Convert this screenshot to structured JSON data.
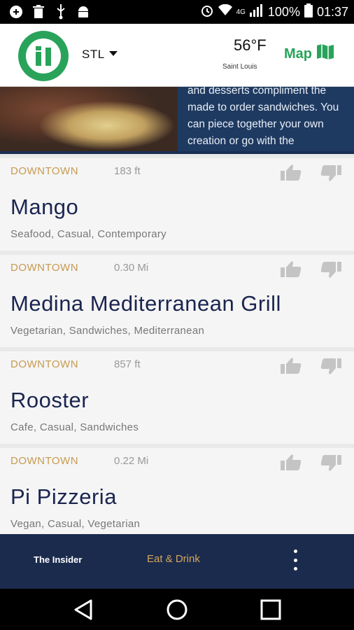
{
  "status_bar": {
    "battery_text": "100%",
    "time": "01:37",
    "network": "4G"
  },
  "header": {
    "city": "STL",
    "temperature": "56°F",
    "weather_city": "Saint Louis",
    "map_label": "Map",
    "brand_color": "#29a35a"
  },
  "banner": {
    "text": "and desserts compliment the made to order sandwiches. You can piece together your own creation or go with the"
  },
  "restaurants": [
    {
      "area": "DOWNTOWN",
      "distance": "183 ft",
      "name": "Mango",
      "tags": "Seafood, Casual, Contemporary"
    },
    {
      "area": "DOWNTOWN",
      "distance": "0.30 Mi",
      "name": "Medina Mediterranean Grill",
      "tags": "Vegetarian, Sandwiches, Mediterranean"
    },
    {
      "area": "DOWNTOWN",
      "distance": "857 ft",
      "name": "Rooster",
      "tags": "Cafe, Casual, Sandwiches"
    },
    {
      "area": "DOWNTOWN",
      "distance": "0.22 Mi",
      "name": "Pi Pizzeria",
      "tags": "Vegan, Casual, Vegetarian"
    }
  ],
  "tabbar": {
    "insider_label": "The Insider",
    "eat_label": "Eat & Drink"
  }
}
